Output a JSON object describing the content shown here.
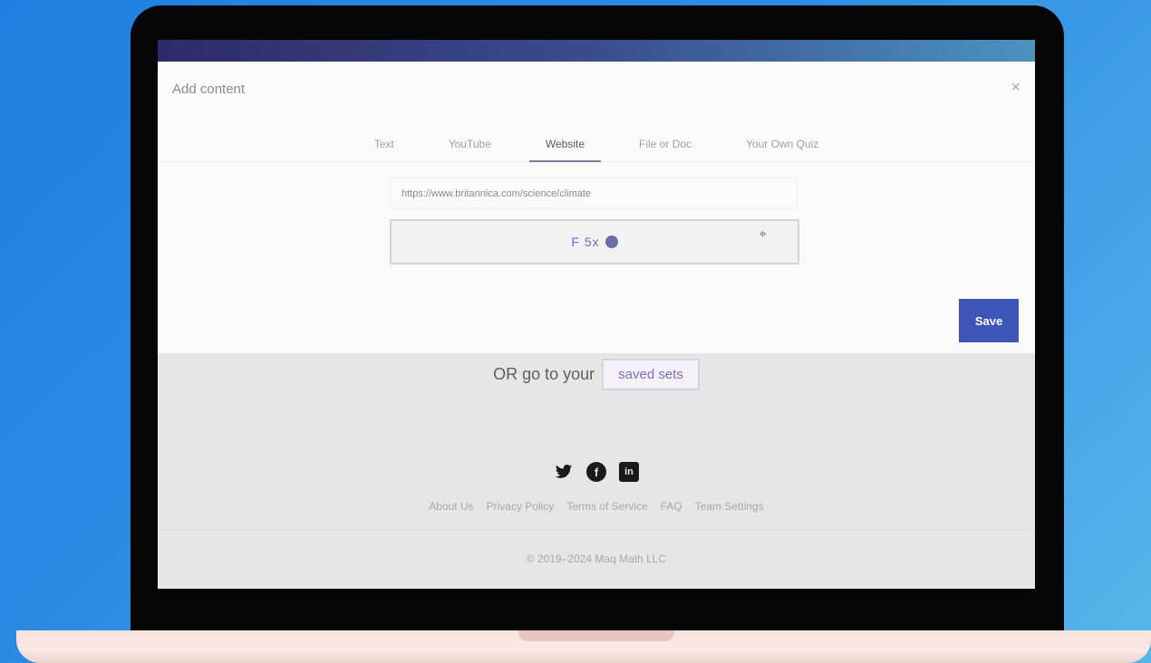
{
  "modal": {
    "title": "Add content",
    "close": "×",
    "tabs": [
      "Text",
      "YouTube",
      "Website",
      "File or Doc",
      "Your Own Quiz"
    ],
    "active_tab": 2,
    "url_value": "https://www.britannica.com/science/climate",
    "preview_text": "F 5x",
    "save_label": "Save"
  },
  "saved": {
    "prefix": "OR go to your",
    "link": "saved sets"
  },
  "social": [
    "twitter-icon",
    "facebook-icon",
    "linkedin-icon"
  ],
  "footer": {
    "links": [
      "About Us",
      "Privacy Policy",
      "Terms of Service",
      "FAQ",
      "Team Settings"
    ],
    "copyright": "© 2019–2024 Maq Math LLC"
  },
  "colors": {
    "accent": "#3d55b5",
    "background_gradient_start": "#1f7fe0",
    "background_gradient_end": "#56b6ea"
  }
}
